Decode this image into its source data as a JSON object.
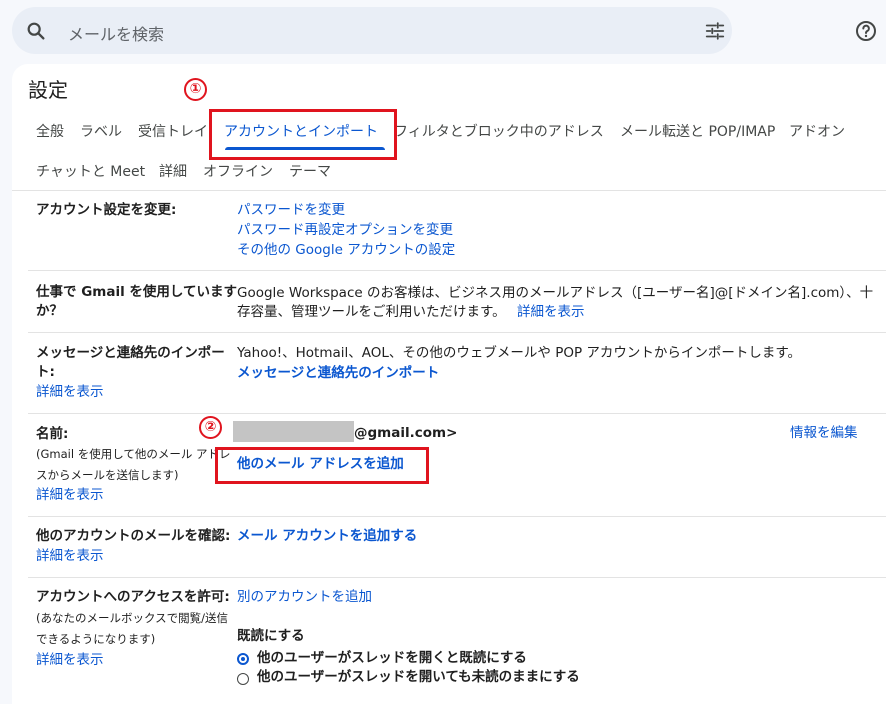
{
  "search": {
    "placeholder": "メールを検索"
  },
  "page": {
    "title": "設定"
  },
  "tabs": [
    {
      "label": "全般"
    },
    {
      "label": "ラベル"
    },
    {
      "label": "受信トレイ"
    },
    {
      "label": "アカウントとインポート",
      "active": true
    },
    {
      "label": "フィルタとブロック中のアドレス"
    },
    {
      "label": "メール転送と POP/IMAP"
    },
    {
      "label": "アドオン"
    },
    {
      "label": "チャットと Meet"
    },
    {
      "label": "詳細"
    },
    {
      "label": "オフライン"
    },
    {
      "label": "テーマ"
    }
  ],
  "annotations": {
    "one": "①",
    "two": "②"
  },
  "sections": {
    "account": {
      "label": "アカウント設定を変更:",
      "links": [
        "パスワードを変更",
        "パスワード再設定オプションを変更",
        "その他の Google アカウントの設定"
      ]
    },
    "workspace": {
      "label1": "仕事で Gmail を使用しています",
      "label2": "か？",
      "text1": "Google Workspace のお客様は、ビジネス用のメールアドレス（[ユーザー名]@[ドメイン名].com）、十",
      "text2": "存容量、管理ツールをご利用いただけます。",
      "more": "詳細を表示"
    },
    "import": {
      "label1": "メッセージと連絡先のインポー",
      "label2": "ト:",
      "more": "詳細を表示",
      "text": "Yahoo!、Hotmail、AOL、その他のウェブメールや POP アカウントからインポートします。",
      "link": "メッセージと連絡先のインポート"
    },
    "name": {
      "label": "名前:",
      "sub1": "(Gmail を使用して他のメール アドレ",
      "sub2": "スからメールを送信します)",
      "more": "詳細を表示",
      "email_suffix": "@gmail.com>",
      "add_link": "他のメール アドレスを追加",
      "edit": "情報を編集"
    },
    "check": {
      "label": "他のアカウントのメールを確認:",
      "more": "詳細を表示",
      "link": "メール アカウントを追加する"
    },
    "grant": {
      "label": "アカウントへのアクセスを許可:",
      "sub1": "(あなたのメールボックスで閲覧/送信",
      "sub2": "できるようになります)",
      "more": "詳細を表示",
      "link": "別のアカウントを追加",
      "read_heading": "既読にする",
      "option1": "他のユーザーがスレッドを開くと既読にする",
      "option2": "他のユーザーがスレッドを開いても未読のままにする"
    }
  },
  "colors": {
    "accent": "#0b57d0",
    "annotation_red": "#e0141e",
    "background": "#f6f8fc"
  }
}
